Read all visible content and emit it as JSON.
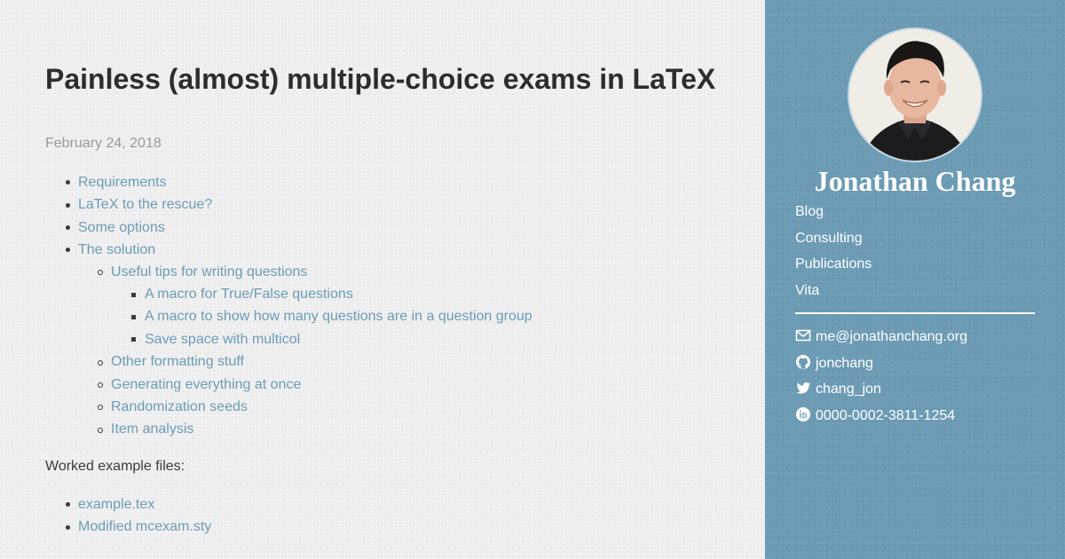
{
  "post": {
    "title": "Painless (almost) multiple-choice exams in LaTeX",
    "date": "February 24, 2018",
    "toc": [
      {
        "label": "Requirements",
        "level": 1
      },
      {
        "label": "LaTeX to the rescue?",
        "level": 1
      },
      {
        "label": "Some options",
        "level": 1
      },
      {
        "label": "The solution",
        "level": 1
      },
      {
        "label": "Useful tips for writing questions",
        "level": 2
      },
      {
        "label": "A macro for True/False questions",
        "level": 3
      },
      {
        "label": "A macro to show how many questions are in a question group",
        "level": 3
      },
      {
        "label": "Save space with multicol",
        "level": 3
      },
      {
        "label": "Other formatting stuff",
        "level": 2
      },
      {
        "label": "Generating everything at once",
        "level": 2
      },
      {
        "label": "Randomization seeds",
        "level": 2
      },
      {
        "label": "Item analysis",
        "level": 2
      }
    ],
    "worked_label": "Worked example files:",
    "files": [
      "example.tex",
      "Modified mcexam.sty"
    ]
  },
  "sidebar": {
    "name": "Jonathan Chang",
    "nav": [
      "Blog",
      "Consulting",
      "Publications",
      "Vita"
    ],
    "contacts": [
      {
        "icon": "envelope-icon",
        "text": "me@jonathanchang.org"
      },
      {
        "icon": "github-icon",
        "text": "jonchang"
      },
      {
        "icon": "twitter-icon",
        "text": "chang_jon"
      },
      {
        "icon": "orcid-icon",
        "text": "0000-0002-3811-1254"
      }
    ]
  },
  "colors": {
    "link": "#6b9cb5",
    "sidebar_bg": "#6c9bb4",
    "main_bg": "#efefef",
    "title": "#2d2d2d",
    "date": "#9a9a9a"
  }
}
